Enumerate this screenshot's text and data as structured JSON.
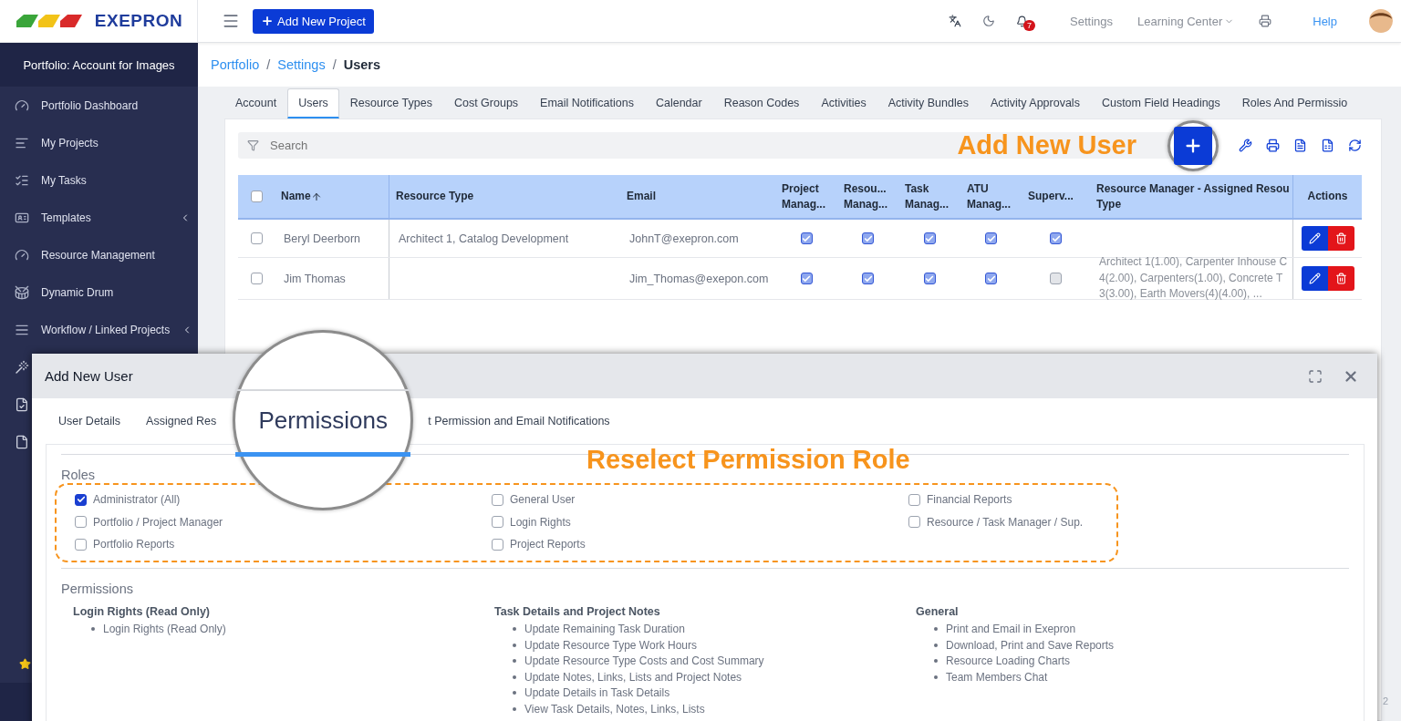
{
  "topbar": {
    "logo": "EXEPRON",
    "add_button": "Add New Project",
    "notifications": "7",
    "links": [
      {
        "label": "Settings",
        "dropdown": false
      },
      {
        "label": "Learning Center",
        "dropdown": true
      }
    ],
    "help": "Help"
  },
  "sidebar": {
    "header": "Portfolio: Account for Images",
    "items": [
      {
        "kind": "link",
        "label": "Portfolio Dashboard",
        "submenu": false
      },
      {
        "kind": "link",
        "label": "My Projects",
        "submenu": false
      },
      {
        "kind": "link",
        "label": "My Tasks",
        "submenu": false
      },
      {
        "kind": "link",
        "label": "Templates",
        "submenu": true
      },
      {
        "kind": "link",
        "label": "Resource Management",
        "submenu": false
      },
      {
        "kind": "link",
        "label": "Dynamic Drum",
        "submenu": false
      },
      {
        "kind": "link",
        "label": "Workflow / Linked Projects",
        "submenu": true
      },
      {
        "kind": "icon"
      },
      {
        "kind": "icon"
      },
      {
        "kind": "icon"
      },
      {
        "kind": "favorite"
      }
    ]
  },
  "breadcrumb": {
    "separator": "/",
    "items": [
      {
        "label": "Portfolio",
        "link": true
      },
      {
        "label": "Settings",
        "link": true
      },
      {
        "label": "Users",
        "link": false
      }
    ]
  },
  "tabs": [
    {
      "label": "Account",
      "selected": false
    },
    {
      "label": "Users",
      "selected": true
    },
    {
      "label": "Resource Types",
      "selected": false
    },
    {
      "label": "Cost Groups",
      "selected": false
    },
    {
      "label": "Email Notifications",
      "selected": false
    },
    {
      "label": "Calendar",
      "selected": false
    },
    {
      "label": "Reason Codes",
      "selected": false
    },
    {
      "label": "Activities",
      "selected": false
    },
    {
      "label": "Activity Bundles",
      "selected": false
    },
    {
      "label": "Activity Approvals",
      "selected": false
    },
    {
      "label": "Custom Field Headings",
      "selected": false
    },
    {
      "label": "Roles And Permissio",
      "selected": false
    }
  ],
  "search": {
    "placeholder": "Search"
  },
  "table": {
    "select_all": false,
    "columns": [
      {
        "label": "Name",
        "sorted": true
      },
      {
        "label": "Resource Type"
      },
      {
        "label": "Email"
      },
      {
        "label": "Project\nManag..."
      },
      {
        "label": "Resou...\nManag..."
      },
      {
        "label": "Task\nManag..."
      },
      {
        "label": "ATU\nManag..."
      },
      {
        "label": "Superv..."
      },
      {
        "label": "Resource Manager - Assigned Resou\nType"
      },
      {
        "label": "Actions"
      }
    ],
    "rows": [
      {
        "selected": false,
        "name": "Beryl Deerborn",
        "resource_type": "Architect 1, Catalog Development",
        "email": "JohnT@exepron.com",
        "flags": [
          true,
          true,
          true,
          true,
          true
        ],
        "assigned": []
      },
      {
        "selected": false,
        "name": "Jim Thomas",
        "resource_type": "",
        "email": "Jim_Thomas@exepon.com",
        "flags": [
          true,
          true,
          true,
          true,
          false
        ],
        "assigned": [
          "Architect 1(1.00),  Carpenter Inhouse C",
          "4(2.00),  Carpenters(1.00),  Concrete T",
          "3(3.00),  Earth Movers(4)(4.00),  ..."
        ]
      }
    ]
  },
  "modal": {
    "title": "Add New User",
    "tabs": [
      {
        "label": "User Details",
        "selected": false
      },
      {
        "label": "Assigned Res",
        "selected": false
      },
      {
        "label": "Permissions",
        "selected": true
      },
      {
        "label": "t Permission and Email Notifications",
        "selected": false
      }
    ],
    "roles": {
      "title": "Roles",
      "columns": [
        [
          {
            "label": "Administrator (All)",
            "checked": true
          },
          {
            "label": "Portfolio / Project Manager",
            "checked": false
          },
          {
            "label": "Portfolio Reports",
            "checked": false
          }
        ],
        [
          {
            "label": "General User",
            "checked": false
          },
          {
            "label": "Login Rights",
            "checked": false
          },
          {
            "label": "Project Reports",
            "checked": false
          }
        ],
        [
          {
            "label": "Financial Reports",
            "checked": false
          },
          {
            "label": "Resource / Task Manager / Sup.",
            "checked": false
          }
        ]
      ]
    },
    "permissions": {
      "title": "Permissions",
      "groups": [
        {
          "title": "Login Rights (Read Only)",
          "items": [
            "Login Rights (Read Only)"
          ]
        },
        {
          "title": "Task Details and Project Notes",
          "items": [
            "Update Remaining Task Duration",
            "Update Resource Type Work Hours",
            "Update Resource Type Costs and Cost Summary",
            "Update Notes, Links, Lists and Project Notes",
            "Update Details in Task Details",
            "View Task Details, Notes, Links, Lists"
          ]
        },
        {
          "title": "General",
          "items": [
            "Print and Email in Exepron",
            "Download, Print and Save Reports",
            "Resource Loading Charts",
            "Team Members Chat"
          ]
        }
      ]
    }
  },
  "annotations": [
    {
      "text": "Add New User"
    },
    {
      "text": "Reselect Permission Role"
    }
  ],
  "page_fragment": "2"
}
